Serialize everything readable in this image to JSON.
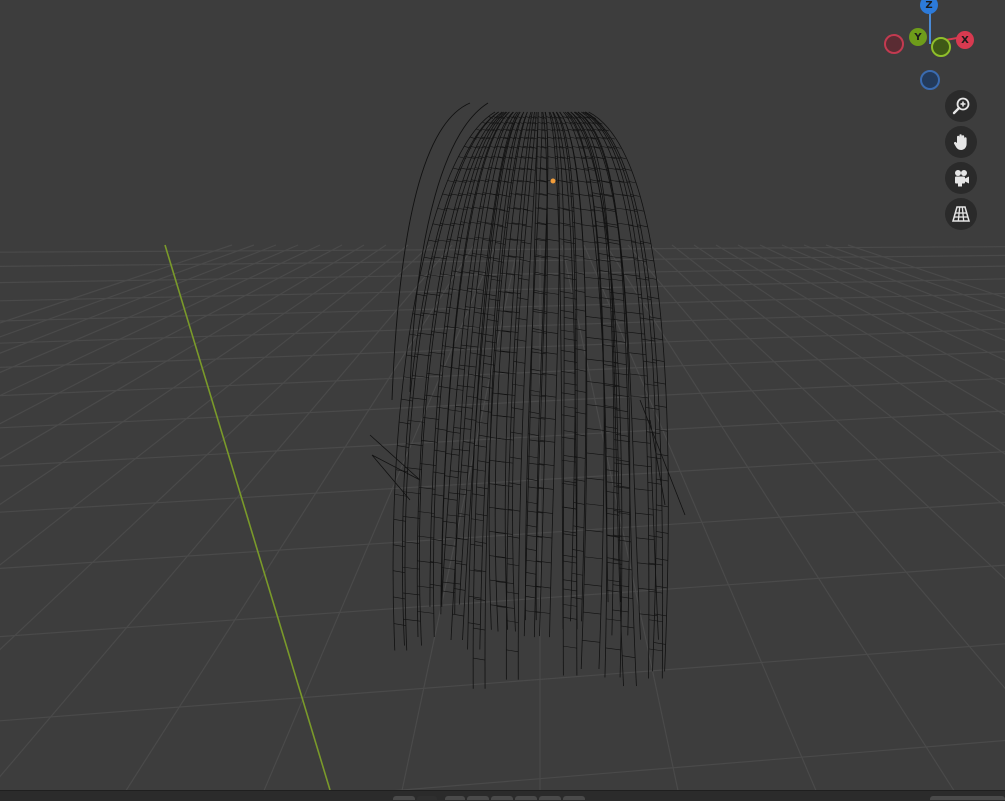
{
  "viewport": {
    "mode": "wireframe",
    "background_color": "#3d3d3d",
    "grid_color": "#4a4a4a",
    "y_axis_color": "#7a9a2a",
    "wire_color": "#111111",
    "origin_color": "#f29d3a"
  },
  "gizmo": {
    "z_label": "Z",
    "y_label": "Y",
    "x_label": "X",
    "z_color": "#2c7ad9",
    "y_color": "#6e9c1a",
    "x_color": "#d83a50"
  },
  "nav_tools": [
    {
      "icon": "zoom-icon"
    },
    {
      "icon": "hand-pan-icon"
    },
    {
      "icon": "camera-icon"
    },
    {
      "icon": "perspective-grid-icon"
    }
  ]
}
